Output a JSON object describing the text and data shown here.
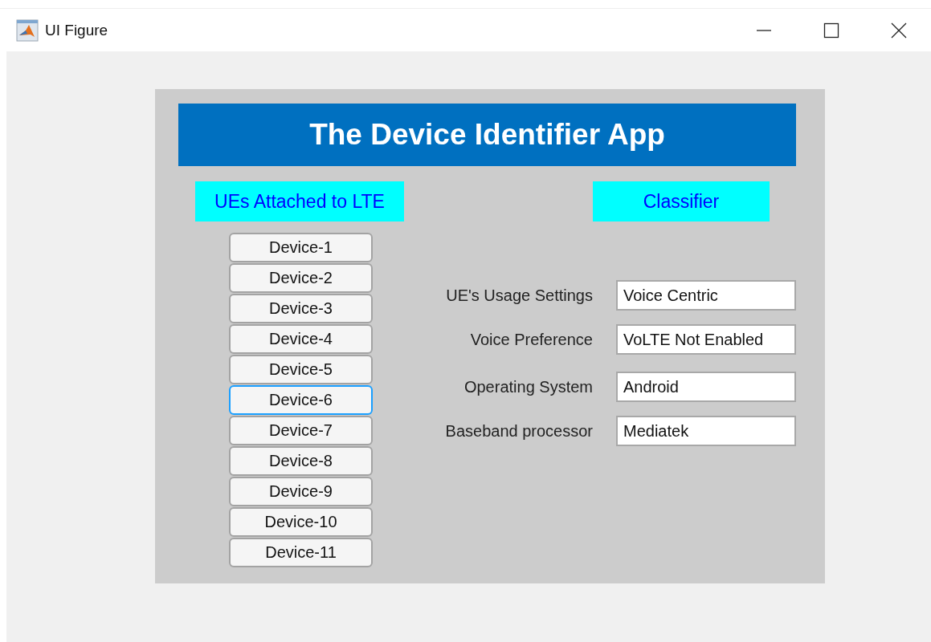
{
  "window": {
    "title": "UI Figure"
  },
  "app_title": "The Device Identifier App",
  "left_heading": "UEs Attached to LTE",
  "right_heading": "Classifier",
  "devices": [
    {
      "label": "Device-1",
      "selected": false
    },
    {
      "label": "Device-2",
      "selected": false
    },
    {
      "label": "Device-3",
      "selected": false
    },
    {
      "label": "Device-4",
      "selected": false
    },
    {
      "label": "Device-5",
      "selected": false
    },
    {
      "label": "Device-6",
      "selected": true
    },
    {
      "label": "Device-7",
      "selected": false
    },
    {
      "label": "Device-8",
      "selected": false
    },
    {
      "label": "Device-9",
      "selected": false
    },
    {
      "label": "Device-10",
      "selected": false
    },
    {
      "label": "Device-11",
      "selected": false
    }
  ],
  "fields": [
    {
      "label": "UE's Usage Settings",
      "value": "Voice Centric"
    },
    {
      "label": "Voice Preference",
      "value": "VoLTE Not Enabled"
    },
    {
      "label": "Operating System",
      "value": "Android"
    },
    {
      "label": "Baseband processor",
      "value": "Mediatek"
    }
  ]
}
